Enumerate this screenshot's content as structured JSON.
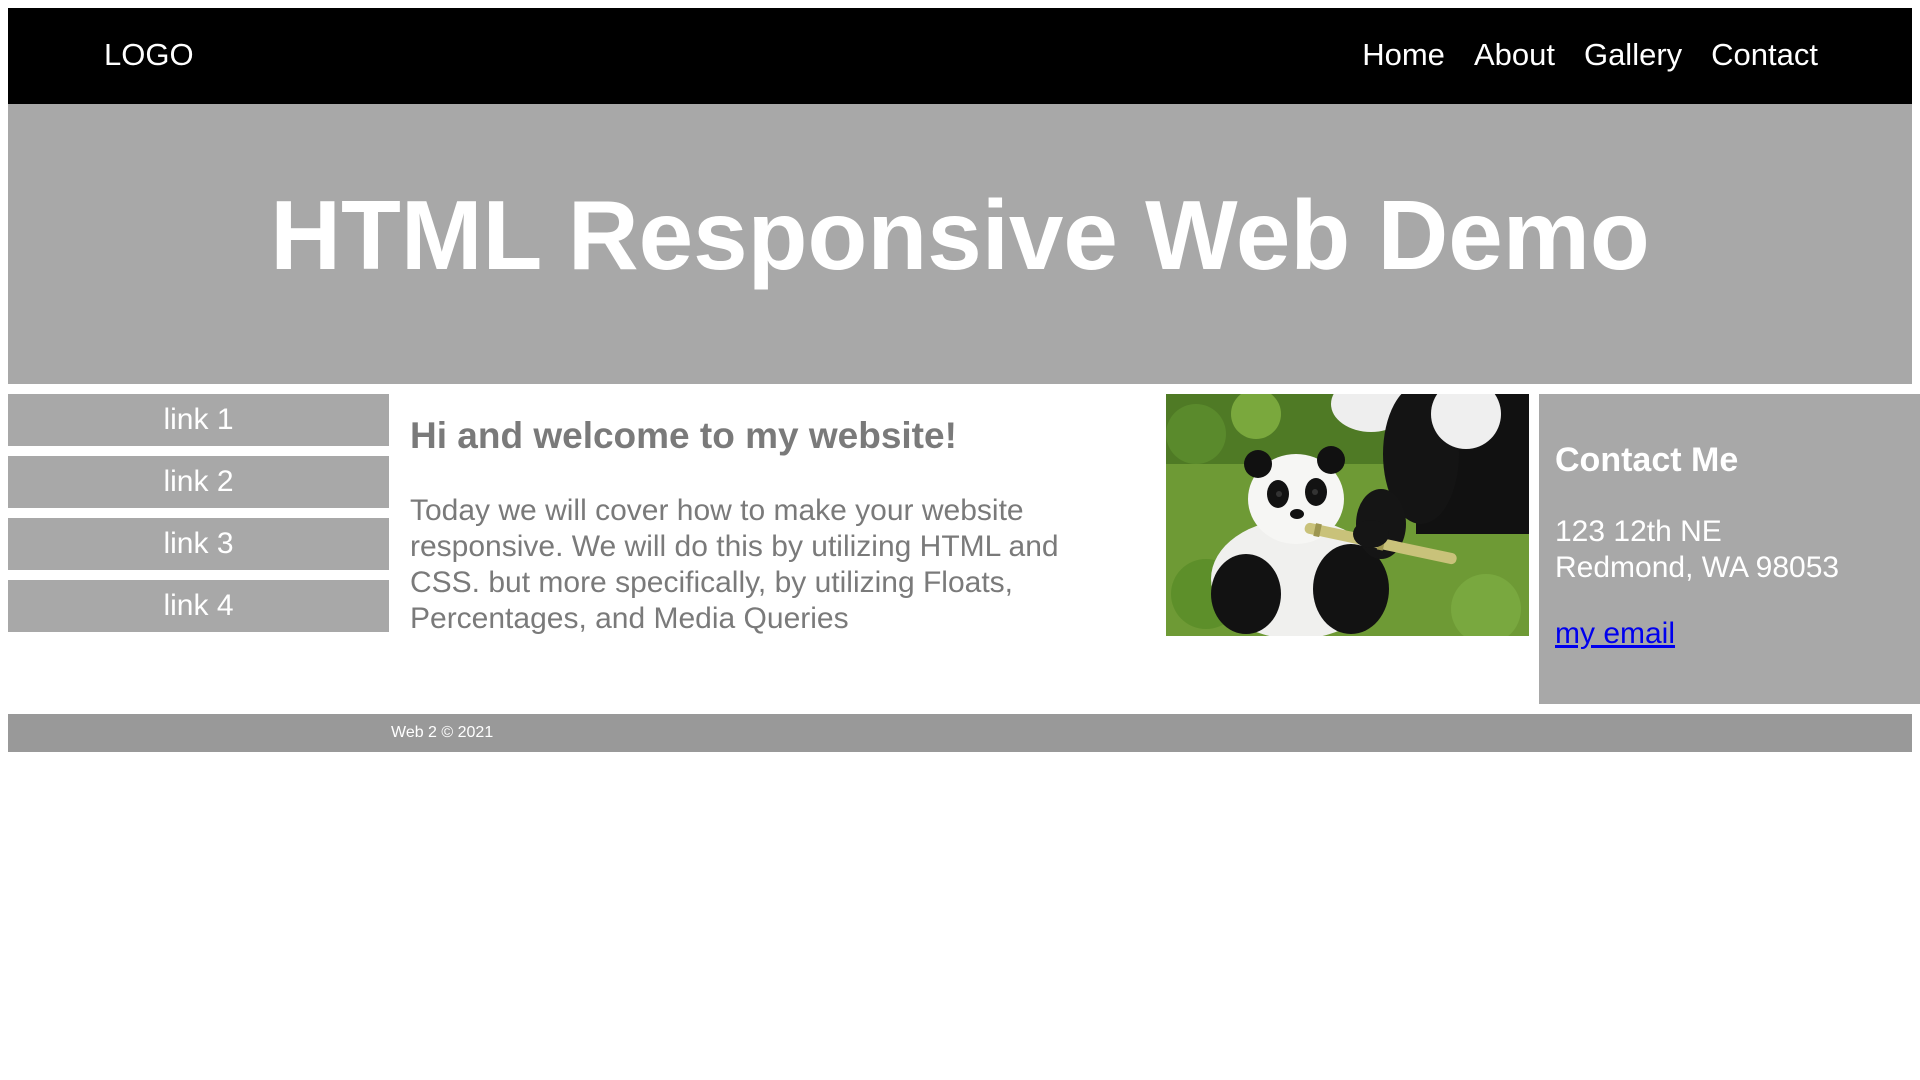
{
  "navbar": {
    "logo": "LOGO",
    "links": [
      "Home",
      "About",
      "Gallery",
      "Contact"
    ]
  },
  "hero": {
    "title": "HTML Responsive Web Demo"
  },
  "sidebar": {
    "links": [
      "link 1",
      "link 2",
      "link 3",
      "link 4"
    ]
  },
  "content": {
    "heading": "Hi and welcome to my website!",
    "paragraph": "Today we will cover how to make your website responsive. We will do this by utilizing HTML and CSS. but more specifically, by utilizing Floats, Percentages, and Media Queries"
  },
  "contact": {
    "title": "Contact Me",
    "address_line1": "123 12th NE",
    "address_line2": "Redmond, WA 98053",
    "email_label": "my email"
  },
  "footer": {
    "text": "Web 2 © 2021"
  },
  "colors": {
    "navbar_bg": "#000000",
    "panel_gray": "#a8a8a8",
    "footer_gray": "#999999",
    "text_gray": "#7a7a7a",
    "link_blue": "#0000ee"
  }
}
